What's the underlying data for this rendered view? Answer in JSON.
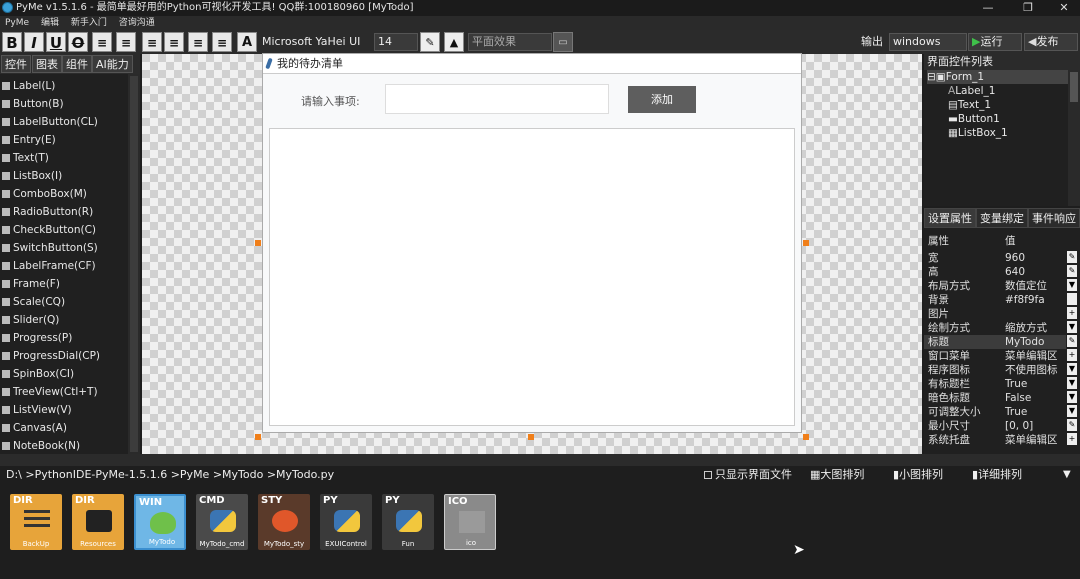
{
  "window": {
    "title": "PyMe v1.5.1.6 - 最简单最好用的Python可视化开发工具! QQ群:100180960 [MyTodo]"
  },
  "menu": [
    "PyMe",
    "编辑",
    "新手入门",
    "咨询沟通"
  ],
  "toolbar": {
    "bold": "B",
    "italic": "I",
    "underline": "U",
    "strike": "O",
    "font": "Microsoft YaHei UI",
    "size": "14",
    "effect": "平面效果",
    "output_label": "输出",
    "platform": "windows",
    "run": "运行",
    "publish": "发布"
  },
  "left_tabs": [
    "控件",
    "图表",
    "组件",
    "AI能力"
  ],
  "widgets": [
    "Label(L)",
    "Button(B)",
    "LabelButton(CL)",
    "Entry(E)",
    "Text(T)",
    "ListBox(I)",
    "ComboBox(M)",
    "RadioButton(R)",
    "CheckButton(C)",
    "SwitchButton(S)",
    "LabelFrame(CF)",
    "Frame(F)",
    "Scale(CQ)",
    "Slider(Q)",
    "Progress(P)",
    "ProgressDial(CP)",
    "SpinBox(CI)",
    "TreeView(Ctl+T)",
    "ListView(V)",
    "Canvas(A)",
    "NoteBook(N)"
  ],
  "form": {
    "title": "我的待办清单",
    "label": "请输入事项:",
    "button": "添加"
  },
  "right": {
    "tree_title": "界面控件列表",
    "tree": [
      "Form_1",
      "Label_1",
      "Text_1",
      "Button1",
      "ListBox_1"
    ],
    "tabs": [
      "设置属性",
      "变量绑定",
      "事件响应"
    ],
    "prop_header": {
      "key": "属性",
      "value": "值"
    },
    "props": [
      {
        "k": "宽",
        "v": "960"
      },
      {
        "k": "高",
        "v": "640"
      },
      {
        "k": "布局方式",
        "v": "数值定位"
      },
      {
        "k": "背景",
        "v": "#f8f9fa"
      },
      {
        "k": "图片",
        "v": ""
      },
      {
        "k": "绘制方式",
        "v": "缩放方式"
      },
      {
        "k": "标题",
        "v": "MyTodo"
      },
      {
        "k": "窗口菜单",
        "v": "菜单编辑区"
      },
      {
        "k": "程序图标",
        "v": "不使用图标"
      },
      {
        "k": "有标题栏",
        "v": "True"
      },
      {
        "k": "暗色标题",
        "v": "False"
      },
      {
        "k": "可调整大小",
        "v": "True"
      },
      {
        "k": "最小尺寸",
        "v": "[0, 0]"
      },
      {
        "k": "系统托盘",
        "v": "菜单编辑区"
      }
    ]
  },
  "path": "D:\\ >PythonIDE-PyMe-1.5.1.6 >PyMe >MyTodo >MyTodo.py",
  "view_options": {
    "only_ui": "只显示界面文件",
    "big": "大图排列",
    "small": "小图排列",
    "detail": "详细排列"
  },
  "files": [
    {
      "type": "DIR",
      "name": "BackUp",
      "color": "#e7a43a"
    },
    {
      "type": "DIR",
      "name": "Resources",
      "color": "#e7a43a"
    },
    {
      "type": "WIN",
      "name": "MyTodo",
      "color": "#6fb7e6"
    },
    {
      "type": "CMD",
      "name": "MyTodo_cmd",
      "color": "#4a4a4a"
    },
    {
      "type": "STY",
      "name": "MyTodo_sty",
      "color": "#5a3a2a"
    },
    {
      "type": "PY",
      "name": "EXUIControl",
      "color": "#3a3a3a"
    },
    {
      "type": "PY",
      "name": "Fun",
      "color": "#3a3a3a"
    },
    {
      "type": "ICO",
      "name": "ico",
      "color": "#8a8a8a"
    }
  ]
}
